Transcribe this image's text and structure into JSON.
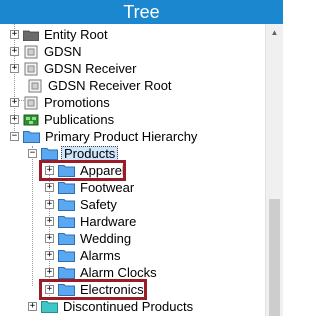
{
  "header": {
    "title": "Tree"
  },
  "tree": {
    "items": [
      {
        "label": "Entity Root",
        "expander": "+",
        "icon": "entity-root-icon"
      },
      {
        "label": "GDSN",
        "expander": "+",
        "icon": "gdsn-icon"
      },
      {
        "label": "GDSN Receiver",
        "expander": "+",
        "icon": "gdsn-receiver-icon"
      },
      {
        "label": "GDSN Receiver Root",
        "expander": "",
        "icon": "gdsn-receiver-root-icon"
      },
      {
        "label": "Promotions",
        "expander": "+",
        "icon": "promotions-icon"
      },
      {
        "label": "Publications",
        "expander": "+",
        "icon": "publications-icon"
      },
      {
        "label": "Primary Product Hierarchy",
        "expander": "−",
        "icon": "folder-icon"
      },
      {
        "label": "Products",
        "expander": "−",
        "icon": "folder-icon",
        "selected": true
      },
      {
        "label": "Apparel",
        "expander": "+",
        "icon": "folder-icon",
        "highlighted": true
      },
      {
        "label": "Footwear",
        "expander": "+",
        "icon": "folder-icon"
      },
      {
        "label": "Safety",
        "expander": "+",
        "icon": "folder-icon"
      },
      {
        "label": "Hardware",
        "expander": "+",
        "icon": "folder-icon"
      },
      {
        "label": "Wedding",
        "expander": "+",
        "icon": "folder-icon"
      },
      {
        "label": "Alarms",
        "expander": "+",
        "icon": "folder-icon"
      },
      {
        "label": "Alarm Clocks",
        "expander": "+",
        "icon": "folder-icon"
      },
      {
        "label": "Electronics",
        "expander": "+",
        "icon": "folder-icon",
        "highlighted": true
      },
      {
        "label": "Discontinued Products",
        "expander": "+",
        "icon": "teal-folder-icon"
      }
    ]
  },
  "colors": {
    "header_bg": "#1b87cf",
    "highlight_border": "#9b1b26",
    "folder_blue": "#5aa7f2",
    "folder_teal": "#3fc7c7"
  },
  "scrollbar": {
    "up_icon": "scroll-up-arrow-icon",
    "down_icon": "scroll-down-arrow-icon"
  }
}
